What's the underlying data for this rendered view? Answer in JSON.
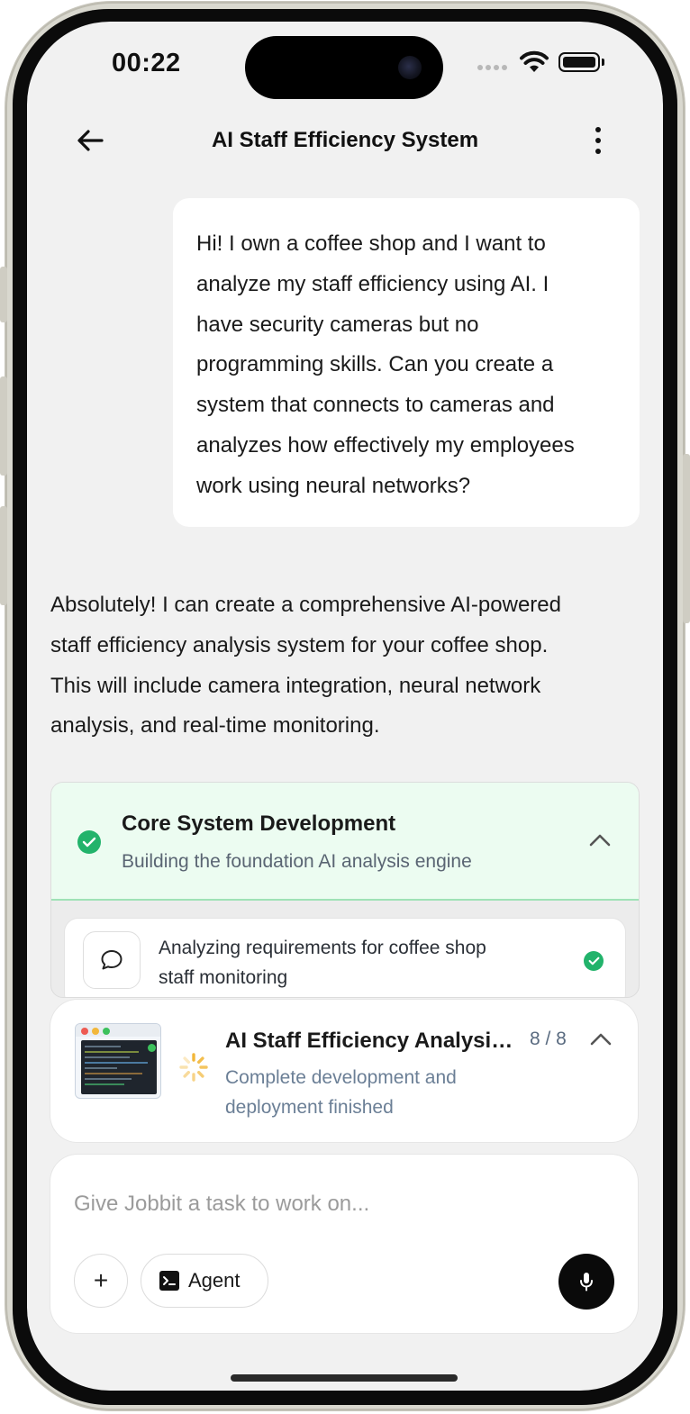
{
  "status_bar": {
    "time": "00:22"
  },
  "header": {
    "title": "AI Staff Efficiency System"
  },
  "user_message": {
    "lines": [
      "Hi! I own a coffee shop and I want to",
      "analyze my staff efficiency using AI. I",
      "have security cameras but no",
      "programming skills. Can you create a",
      "system that connects to cameras and",
      "analyzes how effectively my employees",
      "work using neural networks?"
    ]
  },
  "assistant_message": {
    "lines": [
      "Absolutely! I can create a comprehensive AI-powered",
      "staff efficiency analysis system for your coffee shop.",
      "This will include camera integration, neural network",
      "analysis, and real-time monitoring."
    ]
  },
  "task_group": {
    "title": "Core System Development",
    "subtitle": "Building the foundation AI analysis engine",
    "status_color": "#22b36b",
    "steps": [
      {
        "text_lines": [
          "Analyzing requirements for coffee shop",
          "staff monitoring"
        ],
        "icon": "chat-bubble-icon",
        "done": true
      }
    ]
  },
  "progress": {
    "title": "AI Staff Efficiency Analysis System",
    "count": "8 / 8",
    "desc_lines": [
      "Complete development and",
      "deployment finished"
    ],
    "spinner_color": "#f2b73a"
  },
  "composer": {
    "placeholder": "Give Jobbit a task to work on...",
    "value": "",
    "add_label": "+",
    "agent_label": "Agent"
  }
}
